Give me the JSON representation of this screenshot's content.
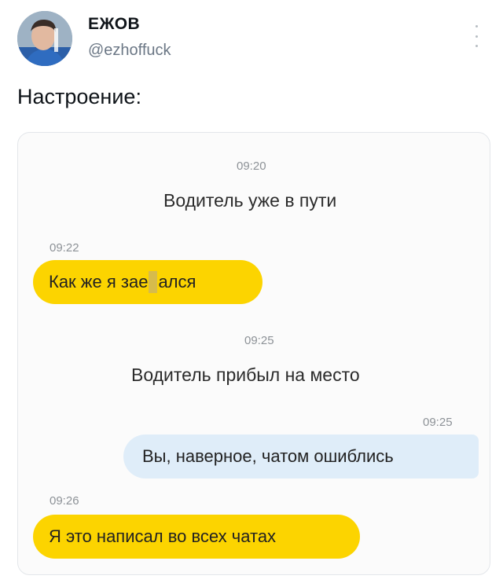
{
  "tweet": {
    "display_name": "ЕЖОВ",
    "handle": "@ezhoffuck",
    "text": "Настроение:",
    "more_icon": "more-vertical-icon"
  },
  "chat": {
    "messages": [
      {
        "time": "09:20",
        "type": "system",
        "text": "Водитель уже в пути"
      },
      {
        "time": "09:22",
        "type": "outgoing-yellow",
        "text_before": "Как же я зае",
        "text_after": "ался",
        "censored": true
      },
      {
        "time": "09:25",
        "type": "system",
        "text": "Водитель прибыл на место"
      },
      {
        "time": "09:25",
        "type": "incoming-blue",
        "text": "Вы, наверное, чатом ошиблись"
      },
      {
        "time": "09:26",
        "type": "outgoing-yellow",
        "text": "Я это написал во всех чатах"
      }
    ],
    "colors": {
      "yellow_bubble": "#fcd400",
      "blue_bubble": "#dfedf9"
    }
  }
}
